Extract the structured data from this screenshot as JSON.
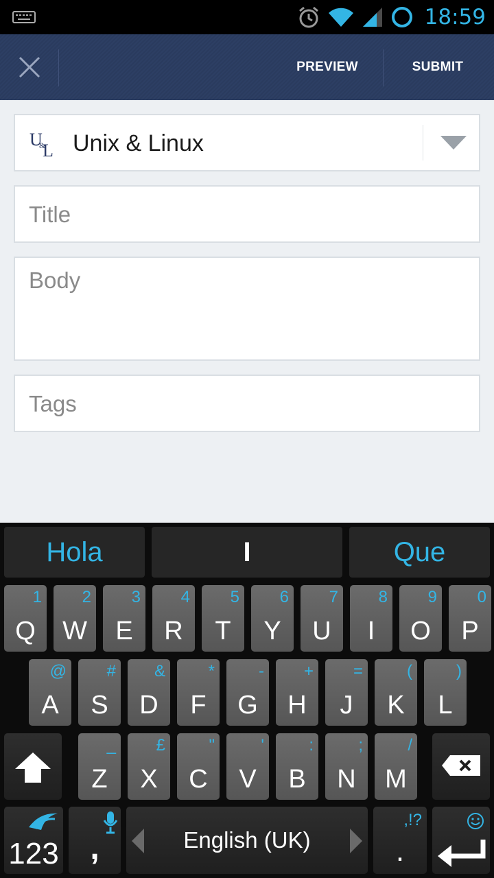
{
  "status_bar": {
    "time": "18:59"
  },
  "action_bar": {
    "preview_label": "PREVIEW",
    "submit_label": "SUBMIT"
  },
  "form": {
    "site": {
      "logo_text": "U&L",
      "name": "Unix & Linux"
    },
    "title_placeholder": "Title",
    "body_placeholder": "Body",
    "tags_placeholder": "Tags"
  },
  "keyboard": {
    "suggestions": [
      "Hola",
      "I",
      "Que"
    ],
    "row1": [
      {
        "main": "Q",
        "sub": "1"
      },
      {
        "main": "W",
        "sub": "2"
      },
      {
        "main": "E",
        "sub": "3"
      },
      {
        "main": "R",
        "sub": "4"
      },
      {
        "main": "T",
        "sub": "5"
      },
      {
        "main": "Y",
        "sub": "6"
      },
      {
        "main": "U",
        "sub": "7"
      },
      {
        "main": "I",
        "sub": "8"
      },
      {
        "main": "O",
        "sub": "9"
      },
      {
        "main": "P",
        "sub": "0"
      }
    ],
    "row2": [
      {
        "main": "A",
        "sub": "@"
      },
      {
        "main": "S",
        "sub": "#"
      },
      {
        "main": "D",
        "sub": "&"
      },
      {
        "main": "F",
        "sub": "*"
      },
      {
        "main": "G",
        "sub": "-"
      },
      {
        "main": "H",
        "sub": "+"
      },
      {
        "main": "J",
        "sub": "="
      },
      {
        "main": "K",
        "sub": "("
      },
      {
        "main": "L",
        "sub": ")"
      }
    ],
    "row3": [
      {
        "main": "Z",
        "sub": "_"
      },
      {
        "main": "X",
        "sub": "£"
      },
      {
        "main": "C",
        "sub": "\""
      },
      {
        "main": "V",
        "sub": "'"
      },
      {
        "main": "B",
        "sub": ":"
      },
      {
        "main": "N",
        "sub": ";"
      },
      {
        "main": "M",
        "sub": "/"
      }
    ],
    "numbers_label": "123",
    "comma_label": ",",
    "language_label": "English (UK)",
    "period_label": ".",
    "period_sub": ",!?"
  },
  "colors": {
    "accent": "#33b5e5",
    "action_bar": "#2c3e63",
    "key": "#5f5f5f"
  }
}
